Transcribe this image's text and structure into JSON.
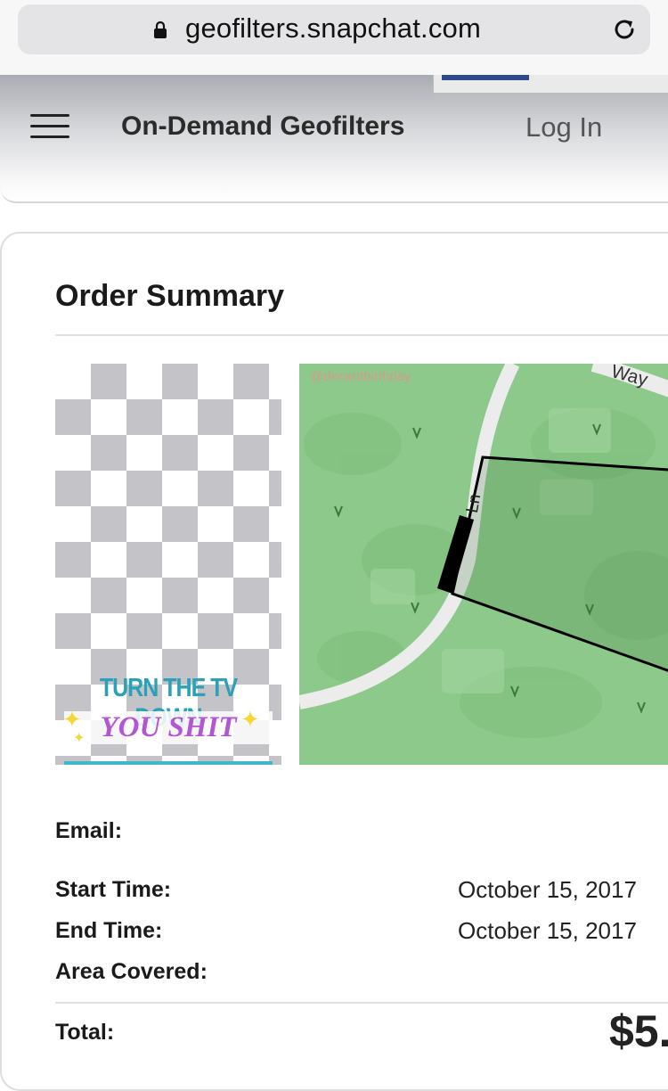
{
  "browser": {
    "url": "geofilters.snapchat.com"
  },
  "header": {
    "title": "On-Demand Geofilters",
    "login_label": "Log In"
  },
  "order": {
    "title": "Order Summary",
    "filter_text": {
      "line1": "TURN THE TV DOWN",
      "line2": "YOU SHIT"
    },
    "map": {
      "watermark": "@decentbirthday",
      "street_way": "Way",
      "street_ln": "Ln"
    },
    "email_label": "Email:",
    "start_label": "Start Time:",
    "start_value": "October 15, 2017",
    "end_label": "End Time:",
    "end_value": "October 15, 2017",
    "area_label": "Area Covered:",
    "total_label": "Total:",
    "total_value": "$5."
  },
  "colors": {
    "map_green": "#8cc98a",
    "checker": "#c4c4c8",
    "fence": "#000000"
  }
}
